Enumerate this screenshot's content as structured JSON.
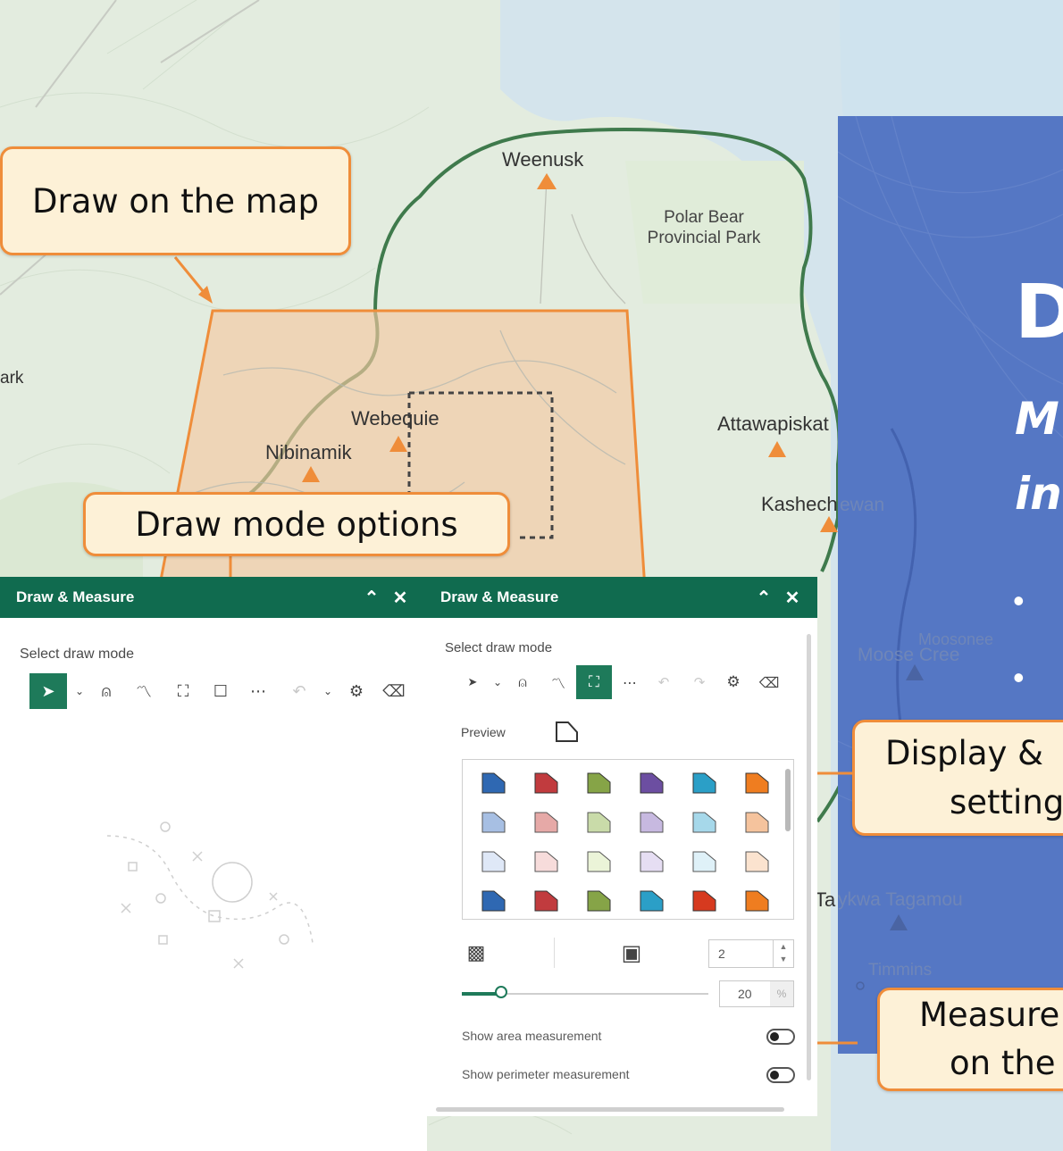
{
  "map": {
    "labels": {
      "weenusk": "Weenusk",
      "polar_bear": "Polar Bear\nProvincial Park",
      "webequie": "Webequie",
      "nibinamik": "Nibinamik",
      "attawapiskat": "Attawapiskat",
      "kashechewan_a": "Kashech",
      "kashechewan_b": "ewan",
      "moosonee": "Moosonee",
      "moose_cree": "Moose Cree",
      "taykwa_a": "Ta",
      "taykwa_b": "ykwa Tagamou",
      "timmins": "Timmins",
      "park_frag": "ark"
    }
  },
  "callouts": {
    "draw_on_map": "Draw on the map",
    "draw_mode_options": "Draw mode options",
    "display_line1": "Display  &",
    "display_line2": "setting",
    "measure_line1": "Measure",
    "measure_line2": "on the"
  },
  "slide": {
    "title_fragment": "D",
    "subtitle_line1": "M",
    "subtitle_line2": "in",
    "bullet": "•"
  },
  "panel_left": {
    "title": "Draw & Measure",
    "select_label": "Select draw mode"
  },
  "panel_right": {
    "title": "Draw & Measure",
    "select_label": "Select draw mode",
    "preview_label": "Preview",
    "stroke_width": "2",
    "opacity_value": "20",
    "opacity_unit": "%",
    "opacity_level": 0.16,
    "show_area": "Show area measurement",
    "show_perimeter": "Show perimeter measurement",
    "swatch_colors": [
      [
        "#2f68b2",
        "#c13b3e",
        "#86a447",
        "#6c4ea1",
        "#2b9fc7",
        "#ef7d20"
      ],
      [
        "#a7bfe3",
        "#e6a9a7",
        "#c9dba9",
        "#c7b9e0",
        "#a6d8ea",
        "#f5c39d"
      ],
      [
        "#dfe8f7",
        "#f7dcdb",
        "#ebf4d8",
        "#e6def3",
        "#dff1f8",
        "#fbe3cf"
      ],
      [
        "#2f68b2",
        "#c13b3e",
        "#86a447",
        "#2b9fc7",
        "#d63a1f",
        "#ef7d20"
      ]
    ]
  },
  "colors": {
    "accent_orange": "#ef8d3a",
    "callout_fill": "#fdf1d7",
    "panel_header": "#106b4f",
    "slide_blue": "#5577c4",
    "river_green": "#3f7a4c"
  }
}
